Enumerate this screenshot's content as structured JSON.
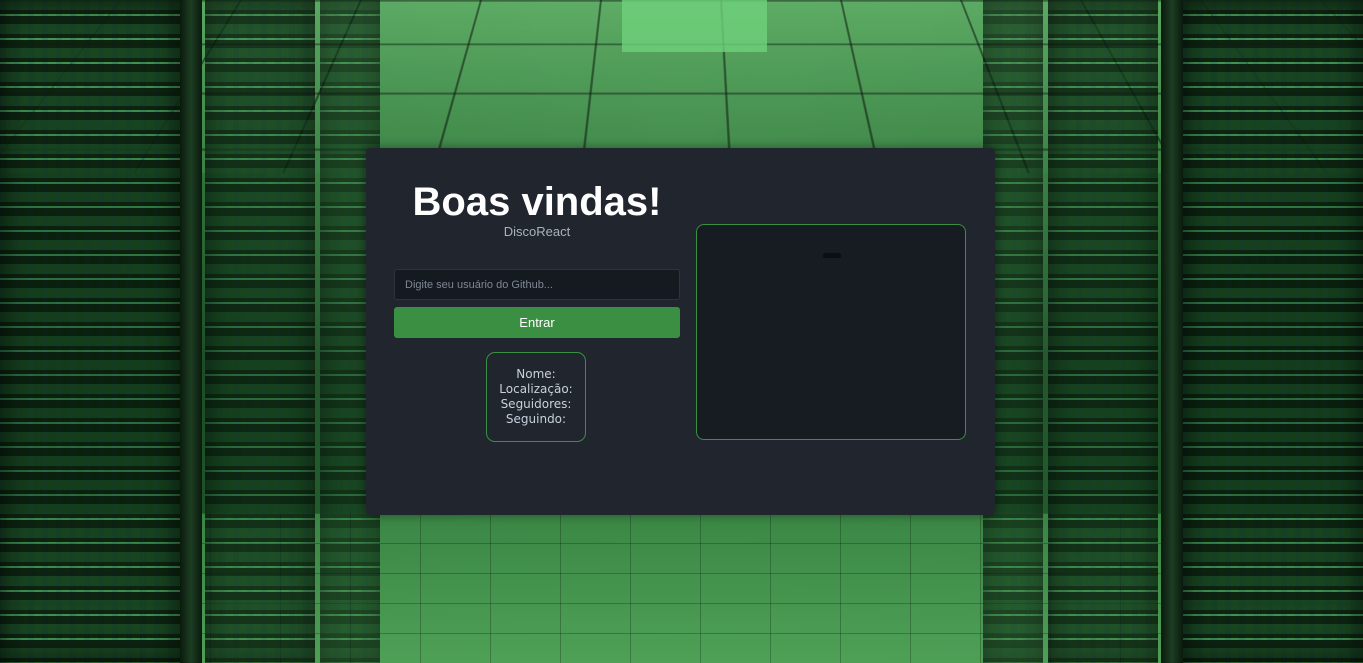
{
  "app": {
    "title": "Boas vindas!",
    "subtitle": "DiscoReact"
  },
  "search": {
    "placeholder": "Digite seu usuário do Github...",
    "value": ""
  },
  "actions": {
    "enter_label": "Entrar"
  },
  "profile": {
    "name_label": "Nome:",
    "location_label": "Localização:",
    "followers_label": "Seguidores:",
    "following_label": "Seguindo:"
  },
  "colors": {
    "accent": "#3a8f42",
    "card_background": "#20252e",
    "panel_background": "#171c23",
    "page_background": "#2c6a37"
  },
  "background": {
    "description_icon": "server-room-background"
  }
}
